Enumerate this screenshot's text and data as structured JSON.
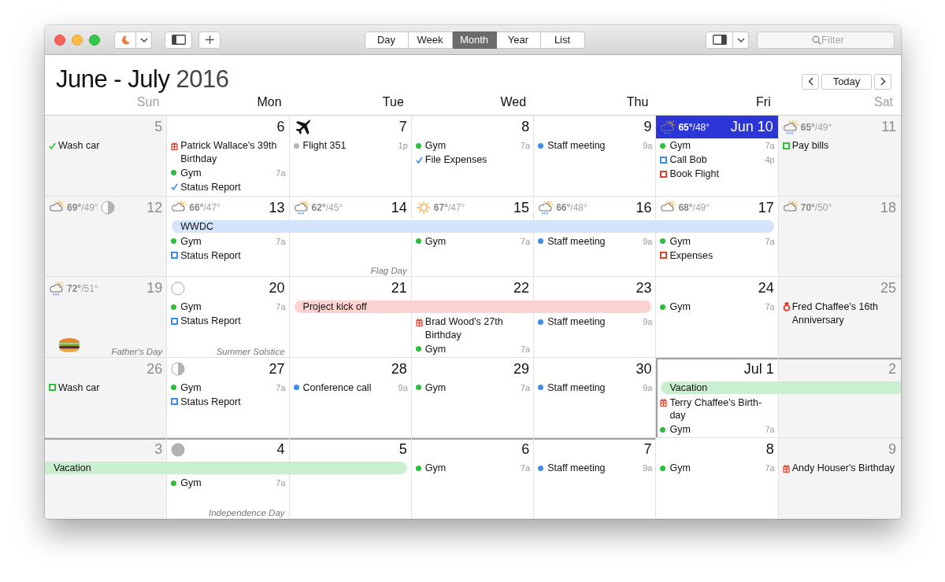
{
  "toolbar": {
    "view_tabs": [
      {
        "label": "Day",
        "selected": false
      },
      {
        "label": "Week",
        "selected": false
      },
      {
        "label": "Month",
        "selected": true
      },
      {
        "label": "Year",
        "selected": false
      },
      {
        "label": "List",
        "selected": false
      }
    ],
    "search": {
      "placeholder": "Filter"
    }
  },
  "header": {
    "title": "June - July",
    "year": "2016",
    "today_button": "Today"
  },
  "weekdays": [
    {
      "label": "Sun",
      "weekend": true
    },
    {
      "label": "Mon",
      "weekend": false
    },
    {
      "label": "Tue",
      "weekend": false
    },
    {
      "label": "Wed",
      "weekend": false
    },
    {
      "label": "Thu",
      "weekend": false
    },
    {
      "label": "Fri",
      "weekend": false
    },
    {
      "label": "Sat",
      "weekend": true
    }
  ],
  "weeks": [
    {
      "days": [
        {
          "label": "5",
          "weekend": true,
          "today": false,
          "events": [
            {
              "kind": "check",
              "color": "#2fbf3c",
              "title": "Wash car"
            }
          ]
        },
        {
          "label": "6",
          "weekend": false,
          "today": false,
          "events": [
            {
              "kind": "gift",
              "color": "#e0402e",
              "title": "Patrick Wallace's 39th Birthday"
            },
            {
              "kind": "dot",
              "color": "#2fbf3c",
              "title": "Gym",
              "time": "7a"
            },
            {
              "kind": "check",
              "color": "#3a8ef0",
              "title": "Status Report"
            }
          ]
        },
        {
          "label": "7",
          "weekend": false,
          "today": false,
          "events": [
            {
              "kind": "dot",
              "color": "#b4b4c4",
              "title": "Flight 351",
              "time": "1p"
            }
          ]
        },
        {
          "label": "8",
          "weekend": false,
          "today": false,
          "events": [
            {
              "kind": "dot",
              "color": "#2fbf3c",
              "title": "Gym",
              "time": "7a"
            },
            {
              "kind": "check",
              "color": "#3a8ef0",
              "title": "File Expenses"
            }
          ]
        },
        {
          "label": "9",
          "weekend": false,
          "today": false,
          "events": [
            {
              "kind": "dot",
              "color": "#3a8ef0",
              "title": "Staff meeting",
              "time": "9a"
            }
          ]
        },
        {
          "label": "Jun 10",
          "weekend": false,
          "today": true,
          "weather": {
            "kind": "sun-rain",
            "temps": "**65°**/48°"
          },
          "events": [
            {
              "kind": "dot",
              "color": "#2fbf3c",
              "title": "Gym",
              "time": "7a"
            },
            {
              "kind": "square",
              "color": "#3a8ef0",
              "title": "Call Bob",
              "time": "4p"
            },
            {
              "kind": "square",
              "color": "#e0402e",
              "title": "Book Flight"
            }
          ]
        },
        {
          "label": "11",
          "weekend": true,
          "today": false,
          "weather": {
            "kind": "sun-rain",
            "temps": "**65°**/49°"
          },
          "events": [
            {
              "kind": "square",
              "color": "#2fbf3c",
              "title": "Pay bills"
            }
          ]
        }
      ]
    },
    {
      "bars": [
        {
          "title": "WWDC",
          "color": "#d6e4fb",
          "continues_before": false,
          "continues_after": false
        }
      ],
      "days": [
        {
          "label": "12",
          "weekend": true,
          "today": false,
          "weather": {
            "kind": "partly-sunny",
            "temps": "**69°**/49°"
          }
        },
        {
          "label": "13",
          "weekend": false,
          "today": false,
          "weather": {
            "kind": "partly-sunny",
            "temps": "**66°**/47°"
          },
          "events": [
            {
              "kind": "dot",
              "color": "#2fbf3c",
              "title": "Gym",
              "time": "7a"
            },
            {
              "kind": "square",
              "color": "#3a8ef0",
              "title": "Status Report"
            }
          ]
        },
        {
          "label": "14",
          "weekend": false,
          "today": false,
          "weather": {
            "kind": "rain",
            "temps": "**62°**/45°"
          },
          "holiday": "Flag Day"
        },
        {
          "label": "15",
          "weekend": false,
          "today": false,
          "weather": {
            "kind": "sunny",
            "temps": "**67°**/47°"
          },
          "events": [
            {
              "kind": "dot",
              "color": "#2fbf3c",
              "title": "Gym",
              "time": "7a"
            }
          ]
        },
        {
          "label": "16",
          "weekend": false,
          "today": false,
          "weather": {
            "kind": "sun-rain",
            "temps": "**66°**/48°"
          },
          "events": [
            {
              "kind": "dot",
              "color": "#3a8ef0",
              "title": "Staff meeting",
              "time": "9a"
            }
          ]
        },
        {
          "label": "17",
          "weekend": false,
          "today": false,
          "weather": {
            "kind": "partly-sunny",
            "temps": "**68°**/49°"
          },
          "events": [
            {
              "kind": "dot",
              "color": "#2fbf3c",
              "title": "Gym",
              "time": "7a"
            },
            {
              "kind": "square",
              "color": "#e0402e",
              "title": "Expenses"
            }
          ]
        },
        {
          "label": "18",
          "weekend": true,
          "today": false,
          "weather": {
            "kind": "partly-sunny",
            "temps": "**70°**/50°"
          }
        }
      ]
    },
    {
      "bars": [
        {
          "title": "Project kick off",
          "color": "#fdd3cf",
          "continues_before": false,
          "continues_after": false
        }
      ],
      "days": [
        {
          "label": "19",
          "weekend": true,
          "today": false,
          "weather": {
            "kind": "sun-rain",
            "temps": "**72°**/51°"
          },
          "holiday": "Father's Day"
        },
        {
          "label": "20",
          "weekend": false,
          "today": false,
          "holiday": "Summer Solstice",
          "events": [
            {
              "kind": "dot",
              "color": "#2fbf3c",
              "title": "Gym",
              "time": "7a"
            },
            {
              "kind": "square",
              "color": "#3a8ef0",
              "title": "Status Report"
            }
          ]
        },
        {
          "label": "21",
          "weekend": false,
          "today": false
        },
        {
          "label": "22",
          "weekend": false,
          "today": false,
          "events": [
            {
              "kind": "gift",
              "color": "#e0402e",
              "title": "Brad Wood's 27th Birthday"
            },
            {
              "kind": "dot",
              "color": "#2fbf3c",
              "title": "Gym",
              "time": "7a"
            }
          ]
        },
        {
          "label": "23",
          "weekend": false,
          "today": false,
          "events": [
            {
              "kind": "dot",
              "color": "#3a8ef0",
              "title": "Staff meeting",
              "time": "9a"
            }
          ]
        },
        {
          "label": "24",
          "weekend": false,
          "today": false,
          "events": [
            {
              "kind": "dot",
              "color": "#2fbf3c",
              "title": "Gym",
              "time": "7a"
            }
          ]
        },
        {
          "label": "25",
          "weekend": true,
          "today": false,
          "events": [
            {
              "kind": "ring",
              "color": "#e0402e",
              "title": "Fred Chaffee's 16th Anniversary"
            }
          ]
        }
      ]
    },
    {
      "bars": [
        {
          "title": "Vacation",
          "color": "#c9efd0",
          "continues_before": false,
          "continues_after": true
        }
      ],
      "days": [
        {
          "label": "26",
          "weekend": true,
          "today": false,
          "events": [
            {
              "kind": "square",
              "color": "#2fbf3c",
              "title": "Wash car"
            }
          ]
        },
        {
          "label": "27",
          "weekend": false,
          "today": false,
          "events": [
            {
              "kind": "dot",
              "color": "#2fbf3c",
              "title": "Gym",
              "time": "7a"
            },
            {
              "kind": "square",
              "color": "#3a8ef0",
              "title": "Status Report"
            }
          ]
        },
        {
          "label": "28",
          "weekend": false,
          "today": false,
          "events": [
            {
              "kind": "dot",
              "color": "#3a8ef0",
              "title": "Conference call",
              "time": "9a"
            }
          ]
        },
        {
          "label": "29",
          "weekend": false,
          "today": false,
          "events": [
            {
              "kind": "dot",
              "color": "#2fbf3c",
              "title": "Gym",
              "time": "7a"
            }
          ]
        },
        {
          "label": "30",
          "weekend": false,
          "today": false,
          "events": [
            {
              "kind": "dot",
              "color": "#3a8ef0",
              "title": "Staff meeting",
              "time": "9a"
            }
          ]
        },
        {
          "label": "Jul 1",
          "weekend": false,
          "today": false,
          "events": [
            {
              "kind": "gift",
              "color": "#e0402e",
              "title": "Terry Chaffee's Birth-day"
            },
            {
              "kind": "dot",
              "color": "#2fbf3c",
              "title": "Gym",
              "time": "7a"
            }
          ]
        },
        {
          "label": "2",
          "weekend": true,
          "today": false
        }
      ]
    },
    {
      "bars": [
        {
          "title": "Vacation",
          "color": "#c9efd0",
          "continues_before": true,
          "continues_after": false
        }
      ],
      "days": [
        {
          "label": "3",
          "weekend": true,
          "today": false
        },
        {
          "label": "4",
          "weekend": false,
          "today": false,
          "holiday": "Independence Day",
          "events": [
            {
              "kind": "dot",
              "color": "#2fbf3c",
              "title": "Gym",
              "time": "7a"
            }
          ]
        },
        {
          "label": "5",
          "weekend": false,
          "today": false
        },
        {
          "label": "6",
          "weekend": false,
          "today": false,
          "events": [
            {
              "kind": "dot",
              "color": "#2fbf3c",
              "title": "Gym",
              "time": "7a"
            }
          ]
        },
        {
          "label": "7",
          "weekend": false,
          "today": false,
          "events": [
            {
              "kind": "dot",
              "color": "#3a8ef0",
              "title": "Staff meeting",
              "time": "9a"
            }
          ]
        },
        {
          "label": "8",
          "weekend": false,
          "today": false,
          "events": [
            {
              "kind": "dot",
              "color": "#2fbf3c",
              "title": "Gym",
              "time": "7a"
            }
          ]
        },
        {
          "label": "9",
          "weekend": true,
          "today": false,
          "events": [
            {
              "kind": "gift",
              "color": "#e0402e",
              "title": "Andy Houser's Birthday"
            }
          ]
        }
      ]
    }
  ]
}
